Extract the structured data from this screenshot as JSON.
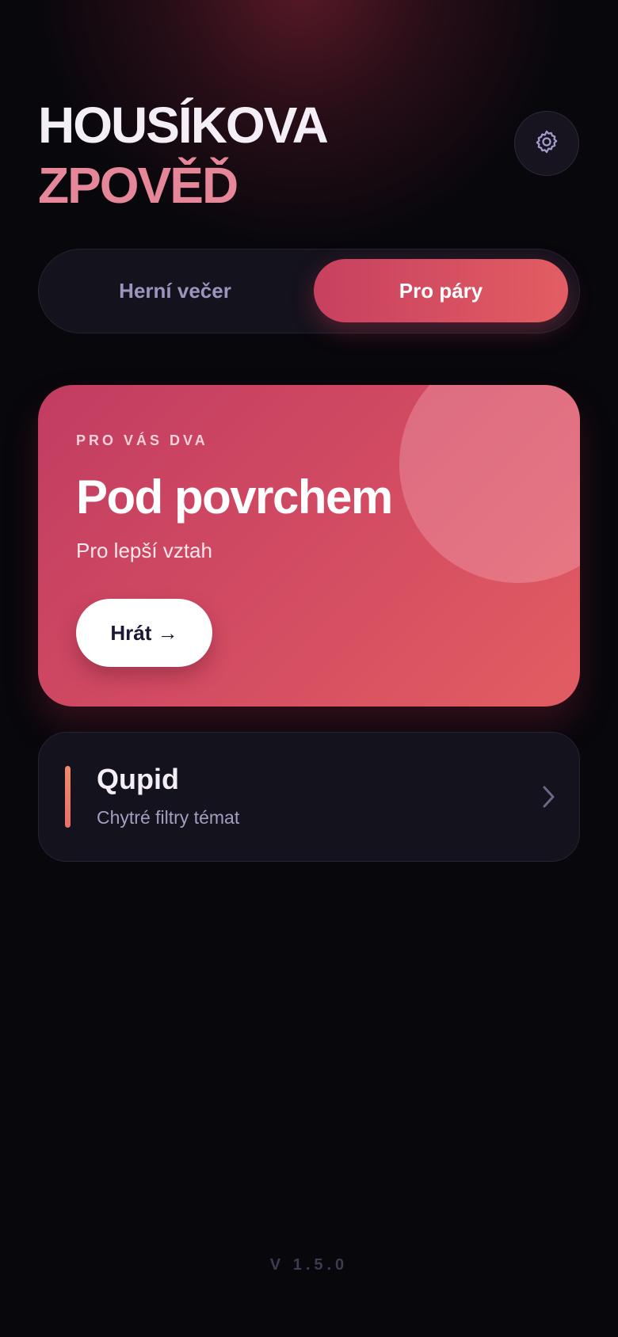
{
  "app": {
    "title_line1": "HOUSÍKOVA",
    "title_line2": "ZPOVĚĎ",
    "settings_icon": "gear-icon"
  },
  "mode_switch": {
    "tabs": [
      {
        "label": "Herní večer",
        "selected": false
      },
      {
        "label": "Pro páry",
        "selected": true
      }
    ]
  },
  "hero_card": {
    "eyebrow": "PRO VÁS DVA",
    "title": "Pod povrchem",
    "subtitle": "Pro lepší vztah",
    "play_label": "Hrát →"
  },
  "list": {
    "items": [
      {
        "title": "Qupid",
        "subtitle": "Chytré filtry témat",
        "chevron_icon": "chevron-right-icon"
      }
    ]
  },
  "footer": {
    "version": "V 1.5.0"
  },
  "colors": {
    "background": "#08070c",
    "accent_pink": "#e58799",
    "card_gradient_start": "#c23c62",
    "card_gradient_end": "#e25d62",
    "accent_bar": "#f08a6a"
  }
}
